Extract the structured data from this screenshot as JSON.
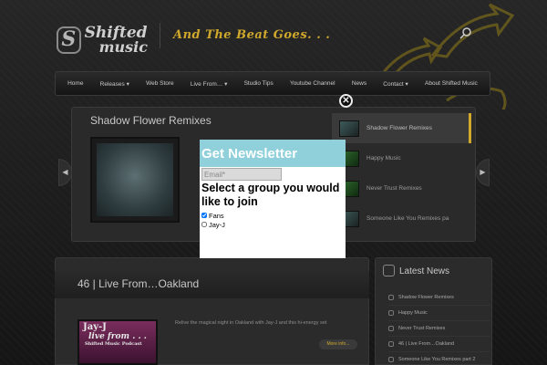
{
  "header": {
    "logo_line1": "Shifted",
    "logo_line2": "music",
    "logo_mark": "S",
    "tagline": "And The Beat Goes. . ."
  },
  "nav": {
    "items": [
      "Home",
      "Releases ▾",
      "Web Store",
      "Live From… ▾",
      "Studio Tips",
      "Youtube Channel",
      "News",
      "Contact ▾",
      "About Shifted Music"
    ]
  },
  "slider": {
    "title": "Shadow Flower Remixes",
    "prev_icon": "chevron-left-icon",
    "next_icon": "chevron-right-icon",
    "prev_glyph": "◀",
    "next_glyph": "▶",
    "side_items": [
      {
        "label": "Shadow Flower Remixes",
        "active": true
      },
      {
        "label": "Happy Music",
        "active": false
      },
      {
        "label": "Never Trust Remixes",
        "active": false
      },
      {
        "label": "Someone Like You Remixes pa",
        "active": false
      }
    ]
  },
  "post": {
    "title": "46 | Live From…Oakland",
    "thumb_line1": "Jay-J",
    "thumb_line2": "live from . . .",
    "thumb_line3": "Shifted Music Podcast",
    "excerpt": "Relive the magical night in Oakland with Jay-J and this hi-energy set",
    "more_label": "More info..."
  },
  "sidebar": {
    "title": "Latest News",
    "items": [
      "Shadow Flower Remixes",
      "Happy Music",
      "Never Trust Remixes",
      "46 | Live From…Oakland",
      "Someone Like You Remixes part 2"
    ]
  },
  "modal": {
    "close_glyph": "✕",
    "title": "Get Newsletter",
    "email_placeholder": "Email*",
    "prompt": "Select a group you would like to join",
    "groups": [
      {
        "label": "Fans",
        "checked": true
      },
      {
        "label": "Jay-J",
        "checked": false
      }
    ]
  },
  "colors": {
    "accent": "#cfa82c",
    "modal_header": "#8fd0da",
    "background": "#1c1c1c"
  }
}
